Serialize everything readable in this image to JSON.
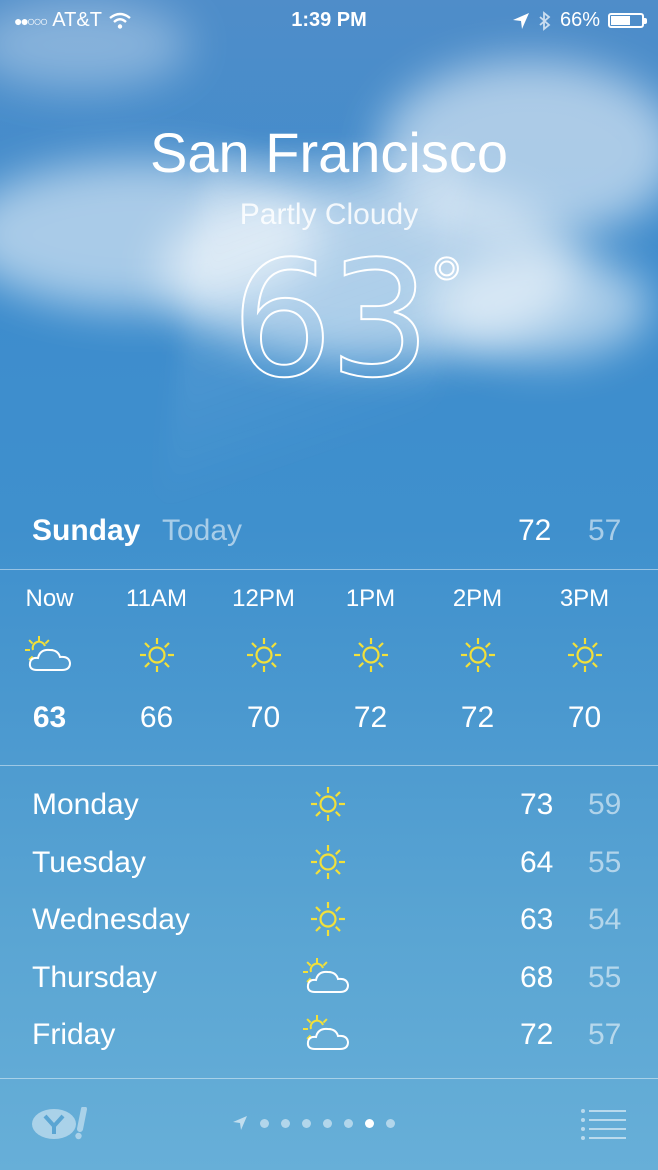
{
  "status_bar": {
    "signal": "●●○○○",
    "carrier": "AT&T",
    "time": "1:39 PM",
    "battery_text": "66%",
    "battery_level": 0.66
  },
  "current": {
    "city": "San Francisco",
    "condition": "Partly Cloudy",
    "temperature": "63",
    "degree_symbol": "°"
  },
  "today": {
    "day": "Sunday",
    "label": "Today",
    "high": "72",
    "low": "57"
  },
  "hourly": [
    {
      "time": "Now",
      "icon": "partly-cloudy-icon",
      "temp": "63"
    },
    {
      "time": "11AM",
      "icon": "sun-icon",
      "temp": "66"
    },
    {
      "time": "12PM",
      "icon": "sun-icon",
      "temp": "70"
    },
    {
      "time": "1PM",
      "icon": "sun-icon",
      "temp": "72"
    },
    {
      "time": "2PM",
      "icon": "sun-icon",
      "temp": "72"
    },
    {
      "time": "3PM",
      "icon": "sun-icon",
      "temp": "70"
    }
  ],
  "daily": [
    {
      "day": "Monday",
      "icon": "sun-icon",
      "high": "73",
      "low": "59"
    },
    {
      "day": "Tuesday",
      "icon": "sun-icon",
      "high": "64",
      "low": "55"
    },
    {
      "day": "Wednesday",
      "icon": "sun-icon",
      "high": "63",
      "low": "54"
    },
    {
      "day": "Thursday",
      "icon": "partly-cloudy-icon",
      "high": "68",
      "low": "55"
    },
    {
      "day": "Friday",
      "icon": "partly-cloudy-icon",
      "high": "72",
      "low": "57"
    }
  ],
  "pager": {
    "count": 7,
    "active_index": 5
  },
  "colors": {
    "sun": "#f2e03a",
    "text": "#ffffff",
    "muted": "rgba(255,255,255,0.55)"
  }
}
